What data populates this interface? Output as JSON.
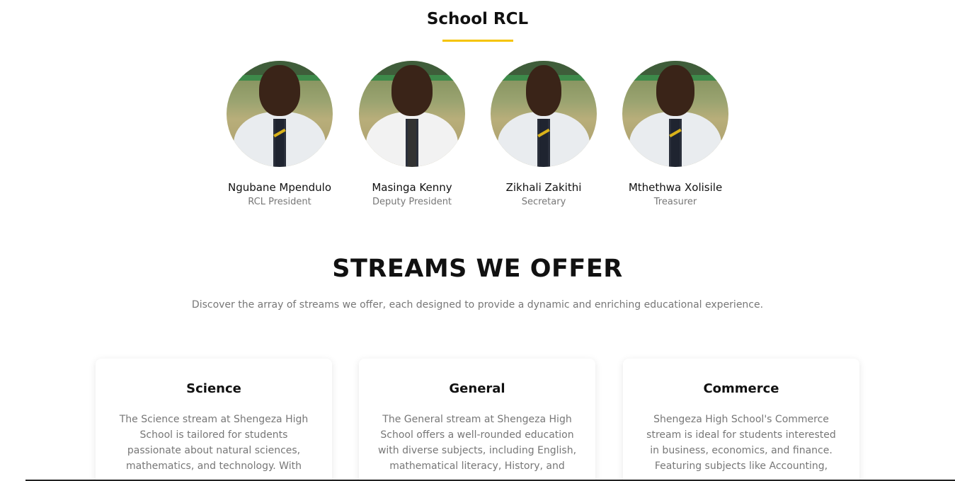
{
  "rcl": {
    "title": "School RCL",
    "accent_color": "#f5c400",
    "members": [
      {
        "name": "Ngubane Mpendulo",
        "role": "RCL President"
      },
      {
        "name": "Masinga Kenny",
        "role": "Deputy President"
      },
      {
        "name": "Zikhali Zakithi",
        "role": "Secretary"
      },
      {
        "name": "Mthethwa Xolisile",
        "role": "Treasurer"
      }
    ]
  },
  "streams": {
    "title": "STREAMS WE OFFER",
    "subtitle": "Discover the array of streams we offer, each designed to provide a dynamic and enriching educational experience.",
    "cards": [
      {
        "title": "Science",
        "text": "The Science stream at Shengeza High School is tailored for students passionate about natural sciences, mathematics, and technology. With"
      },
      {
        "title": "General",
        "text": "The General stream at Shengeza High School offers a well-rounded education with diverse subjects, including English, mathematical literacy, History, and"
      },
      {
        "title": "Commerce",
        "text": "Shengeza High School's Commerce stream is ideal for students interested in business, economics, and finance. Featuring subjects like Accounting,"
      }
    ]
  }
}
